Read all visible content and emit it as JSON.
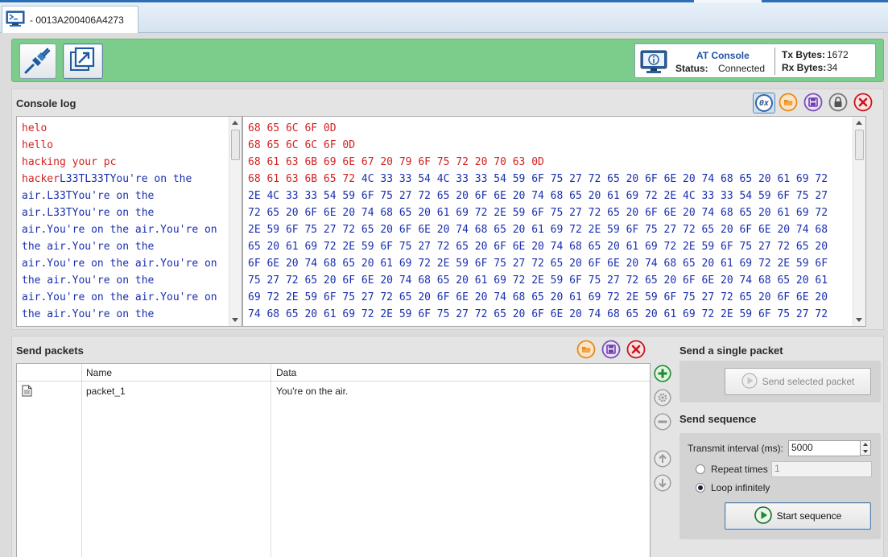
{
  "tab": {
    "label": "- 0013A200406A4273"
  },
  "status": {
    "title": "AT Console",
    "status_label": "Status:",
    "status_value": "Connected",
    "tx_label": "Tx Bytes:",
    "tx_value": "1672",
    "rx_label": "Rx Bytes:",
    "rx_value": "34"
  },
  "console": {
    "title": "Console log",
    "hex_toggle_label": "0x",
    "ascii_lines": [
      {
        "text": "helo",
        "color": "red"
      },
      {
        "text": "hello",
        "color": "red"
      },
      {
        "text": "hacking your pc",
        "color": "red"
      },
      {
        "red": "hacker",
        "blue": "L33TL33TYou're on the"
      },
      {
        "text": "air.L33TYou're on the",
        "color": "blue"
      },
      {
        "text": "air.L33TYou're on the",
        "color": "blue"
      },
      {
        "text": "air.You're on the air.You're on",
        "color": "blue"
      },
      {
        "text": "the air.You're on the",
        "color": "blue"
      },
      {
        "text": "air.You're on the air.You're on",
        "color": "blue"
      },
      {
        "text": "the air.You're on the",
        "color": "blue"
      },
      {
        "text": "air.You're on the air.You're on",
        "color": "blue"
      },
      {
        "text": "the air.You're on the",
        "color": "blue"
      }
    ],
    "hex_lines": [
      {
        "text": "68 65 6C 6F 0D",
        "color": "red"
      },
      {
        "text": "68 65 6C 6C 6F 0D",
        "color": "red"
      },
      {
        "text": "68 61 63 6B 69 6E 67 20 79 6F 75 72 20 70 63 0D",
        "color": "red"
      },
      {
        "red": "68 61 63 6B 65 72 ",
        "blue": "4C 33 33 54 4C 33 33 54 59 6F 75 27 72 65 20 6F 6E 20 74 68 65 20 61 69 72"
      },
      {
        "text": "2E 4C 33 33 54 59 6F 75 27 72 65 20 6F 6E 20 74 68 65 20 61 69 72 2E 4C 33 33 54 59 6F 75 27",
        "color": "blue"
      },
      {
        "text": "72 65 20 6F 6E 20 74 68 65 20 61 69 72 2E 59 6F 75 27 72 65 20 6F 6E 20 74 68 65 20 61 69 72",
        "color": "blue"
      },
      {
        "text": "2E 59 6F 75 27 72 65 20 6F 6E 20 74 68 65 20 61 69 72 2E 59 6F 75 27 72 65 20 6F 6E 20 74 68",
        "color": "blue"
      },
      {
        "text": "65 20 61 69 72 2E 59 6F 75 27 72 65 20 6F 6E 20 74 68 65 20 61 69 72 2E 59 6F 75 27 72 65 20",
        "color": "blue"
      },
      {
        "text": "6F 6E 20 74 68 65 20 61 69 72 2E 59 6F 75 27 72 65 20 6F 6E 20 74 68 65 20 61 69 72 2E 59 6F",
        "color": "blue"
      },
      {
        "text": "75 27 72 65 20 6F 6E 20 74 68 65 20 61 69 72 2E 59 6F 75 27 72 65 20 6F 6E 20 74 68 65 20 61",
        "color": "blue"
      },
      {
        "text": "69 72 2E 59 6F 75 27 72 65 20 6F 6E 20 74 68 65 20 61 69 72 2E 59 6F 75 27 72 65 20 6F 6E 20",
        "color": "blue"
      },
      {
        "text": "74 68 65 20 61 69 72 2E 59 6F 75 27 72 65 20 6F 6E 20 74 68 65 20 61 69 72 2E 59 6F 75 27 72",
        "color": "blue"
      }
    ],
    "colors": {
      "red": "#d41f1f",
      "blue": "#1a2fb0"
    }
  },
  "send_packets": {
    "title": "Send packets",
    "columns": [
      "Name",
      "Data"
    ],
    "rows": [
      {
        "name": "packet_1",
        "data": "You're on the air."
      }
    ]
  },
  "single_packet": {
    "title": "Send a single packet",
    "button_label": "Send selected packet"
  },
  "sequence": {
    "title": "Send sequence",
    "interval_label": "Transmit interval (ms):",
    "interval_value": "5000",
    "repeat_label": "Repeat times",
    "repeat_value": "1",
    "loop_label": "Loop infinitely",
    "start_label": "Start sequence"
  },
  "icons": {
    "tab": "terminal-icon",
    "connect": "plug-icon",
    "detach": "detach-window-icon",
    "monitor": "monitor-info-icon",
    "load": "load-icon",
    "save": "save-icon",
    "lock": "lock-icon",
    "clear": "clear-icon",
    "add": "add-icon",
    "edit": "gear-icon",
    "remove": "remove-icon",
    "up": "move-up-icon",
    "down": "move-down-icon",
    "play": "play-icon",
    "packet": "document-icon"
  }
}
